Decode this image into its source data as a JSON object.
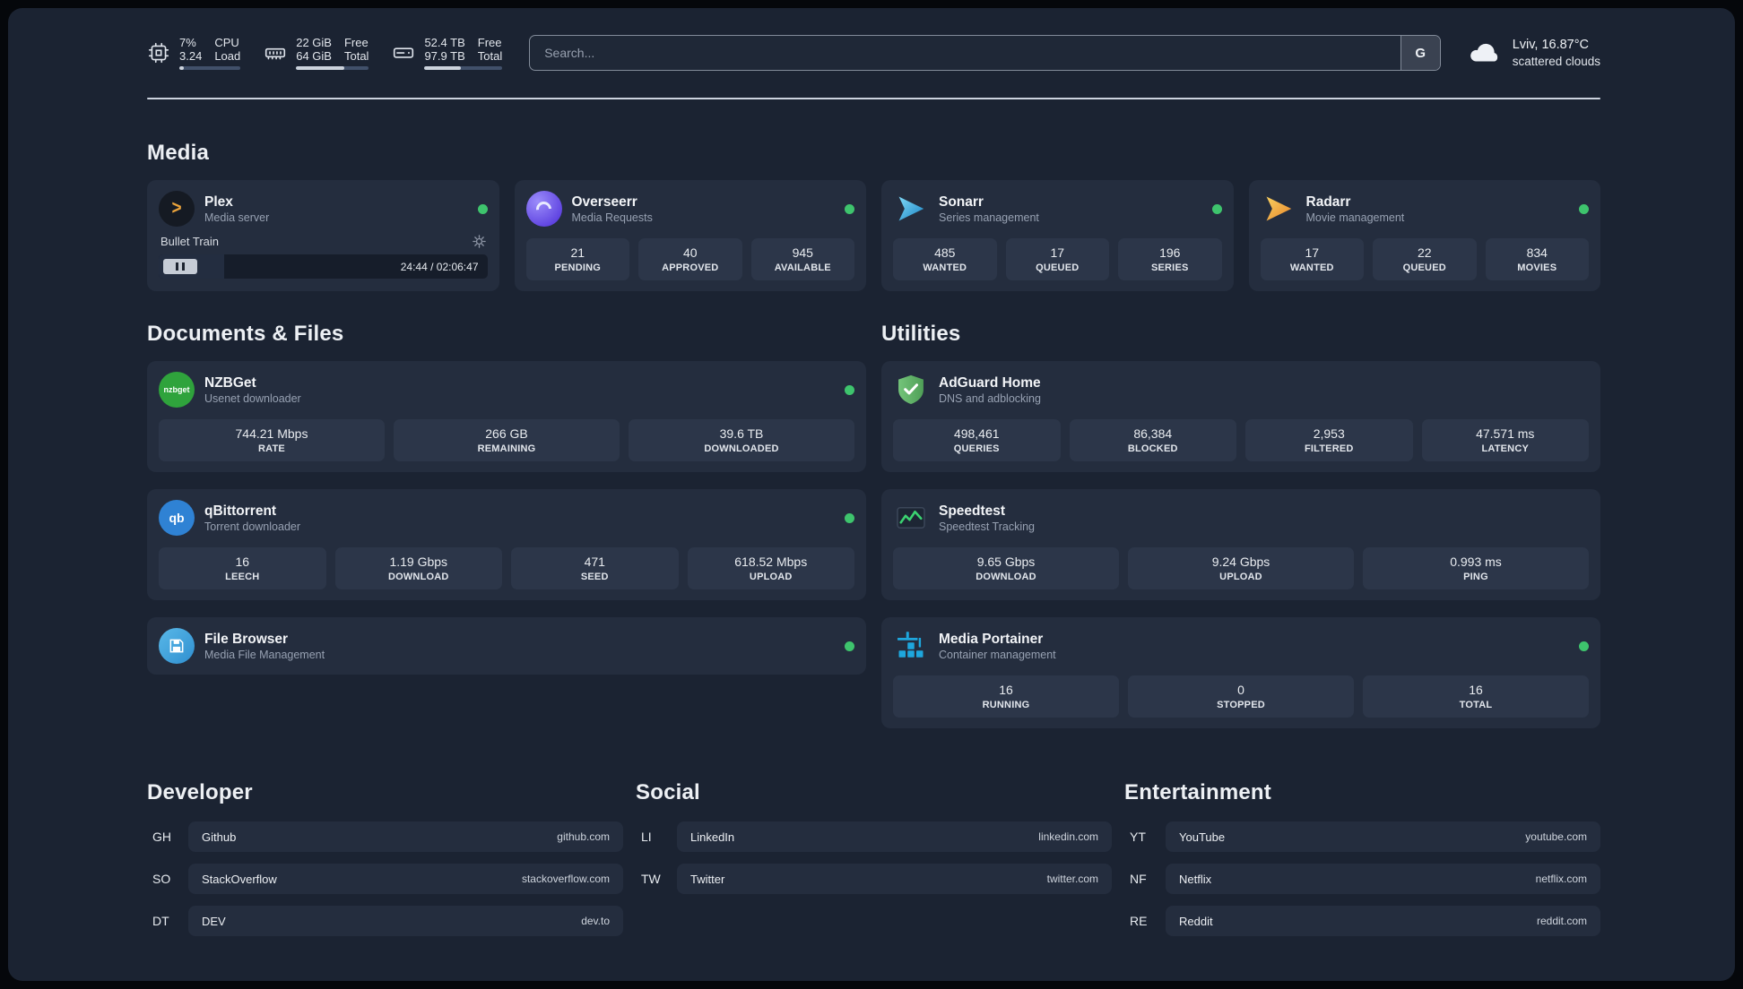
{
  "theme": {
    "background": "#1b2332",
    "card": "#242d3e",
    "tile": "#2c3649",
    "status_green": "#3ec46d",
    "plex_orange": "#e9a23b",
    "portainer_blue": "#1ea7dd"
  },
  "topbar": {
    "cpu": {
      "value1": "7%",
      "value2": "3.24",
      "label1": "CPU",
      "label2": "Load",
      "bar": "7%"
    },
    "ram": {
      "value1": "22 GiB",
      "value2": "64 GiB",
      "label1": "Free",
      "label2": "Total",
      "bar": "66%"
    },
    "disk": {
      "value1": "52.4 TB",
      "value2": "97.9 TB",
      "label1": "Free",
      "label2": "Total",
      "bar": "47%"
    },
    "search": {
      "placeholder": "Search...",
      "engine_button": "G"
    },
    "weather": {
      "location": "Lviv, 16.87°C",
      "condition": "scattered clouds"
    }
  },
  "sections": {
    "media": "Media",
    "documents": "Documents & Files",
    "utilities": "Utilities",
    "developer": "Developer",
    "social": "Social",
    "entertainment": "Entertainment"
  },
  "apps": {
    "plex": {
      "name": "Plex",
      "subtitle": "Media server",
      "now_playing": "Bullet Train",
      "time": "24:44 / 02:06:47",
      "progress": "20%"
    },
    "overseerr": {
      "name": "Overseerr",
      "subtitle": "Media Requests",
      "stats": [
        {
          "value": "21",
          "label": "PENDING"
        },
        {
          "value": "40",
          "label": "APPROVED"
        },
        {
          "value": "945",
          "label": "AVAILABLE"
        }
      ]
    },
    "sonarr": {
      "name": "Sonarr",
      "subtitle": "Series management",
      "stats": [
        {
          "value": "485",
          "label": "WANTED"
        },
        {
          "value": "17",
          "label": "QUEUED"
        },
        {
          "value": "196",
          "label": "SERIES"
        }
      ]
    },
    "radarr": {
      "name": "Radarr",
      "subtitle": "Movie management",
      "stats": [
        {
          "value": "17",
          "label": "WANTED"
        },
        {
          "value": "22",
          "label": "QUEUED"
        },
        {
          "value": "834",
          "label": "MOVIES"
        }
      ]
    },
    "nzbget": {
      "name": "NZBGet",
      "subtitle": "Usenet downloader",
      "stats": [
        {
          "value": "744.21 Mbps",
          "label": "RATE"
        },
        {
          "value": "266 GB",
          "label": "REMAINING"
        },
        {
          "value": "39.6 TB",
          "label": "DOWNLOADED"
        }
      ]
    },
    "qbittorrent": {
      "name": "qBittorrent",
      "subtitle": "Torrent downloader",
      "stats": [
        {
          "value": "16",
          "label": "LEECH"
        },
        {
          "value": "1.19 Gbps",
          "label": "DOWNLOAD"
        },
        {
          "value": "471",
          "label": "SEED"
        },
        {
          "value": "618.52 Mbps",
          "label": "UPLOAD"
        }
      ]
    },
    "filebrowser": {
      "name": "File Browser",
      "subtitle": "Media File Management"
    },
    "adguard": {
      "name": "AdGuard Home",
      "subtitle": "DNS and adblocking",
      "stats": [
        {
          "value": "498,461",
          "label": "QUERIES"
        },
        {
          "value": "86,384",
          "label": "BLOCKED"
        },
        {
          "value": "2,953",
          "label": "FILTERED"
        },
        {
          "value": "47.571 ms",
          "label": "LATENCY"
        }
      ]
    },
    "speedtest": {
      "name": "Speedtest",
      "subtitle": "Speedtest Tracking",
      "stats": [
        {
          "value": "9.65 Gbps",
          "label": "DOWNLOAD"
        },
        {
          "value": "9.24 Gbps",
          "label": "UPLOAD"
        },
        {
          "value": "0.993 ms",
          "label": "PING"
        }
      ]
    },
    "portainer": {
      "name": "Media Portainer",
      "subtitle": "Container management",
      "stats": [
        {
          "value": "16",
          "label": "RUNNING"
        },
        {
          "value": "0",
          "label": "STOPPED"
        },
        {
          "value": "16",
          "label": "TOTAL"
        }
      ]
    }
  },
  "bookmarks": {
    "developer": [
      {
        "abbr": "GH",
        "name": "Github",
        "url": "github.com"
      },
      {
        "abbr": "SO",
        "name": "StackOverflow",
        "url": "stackoverflow.com"
      },
      {
        "abbr": "DT",
        "name": "DEV",
        "url": "dev.to"
      }
    ],
    "social": [
      {
        "abbr": "LI",
        "name": "LinkedIn",
        "url": "linkedin.com"
      },
      {
        "abbr": "TW",
        "name": "Twitter",
        "url": "twitter.com"
      }
    ],
    "entertainment": [
      {
        "abbr": "YT",
        "name": "YouTube",
        "url": "youtube.com"
      },
      {
        "abbr": "NF",
        "name": "Netflix",
        "url": "netflix.com"
      },
      {
        "abbr": "RE",
        "name": "Reddit",
        "url": "reddit.com"
      }
    ]
  },
  "icons": {
    "plex_glyph": ">",
    "nzbget_text": "nzbget",
    "qbittorrent_text": "qb"
  }
}
